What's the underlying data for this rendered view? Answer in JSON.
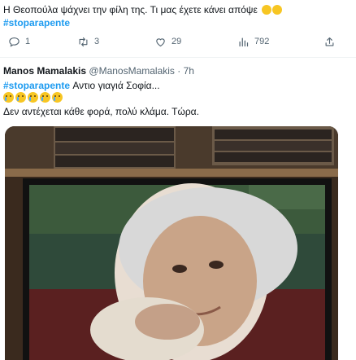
{
  "tweet1": {
    "text": "Η Θεοπούλα ψάχνει την φίλη της. Τι μας έχετε κάνει απόψε",
    "hashtag": "#stoparapente",
    "actions": {
      "replies": "1",
      "retweets": "3",
      "likes": "29",
      "views": "792"
    }
  },
  "tweet2": {
    "author_name": "Manos Mamalakis",
    "handle": "@ManosMamalakis",
    "time": "· 7h",
    "hashtag": "#stoparapente",
    "text_line1": " Αντιο γιαγιά Σοφία...",
    "text_line2": "Δεν αντέχεται κάθε φορά, πολύ κλάμα. Τώρα.",
    "emoji_count": 5,
    "media_alt": "TV screen showing an elderly woman with grey hair"
  },
  "colors": {
    "accent": "#1d9bf0",
    "text": "#0f1419",
    "muted": "#536471"
  },
  "icons": {
    "reply": "reply-icon",
    "retweet": "retweet-icon",
    "like": "heart-icon",
    "views": "views-icon",
    "share": "share-icon"
  }
}
